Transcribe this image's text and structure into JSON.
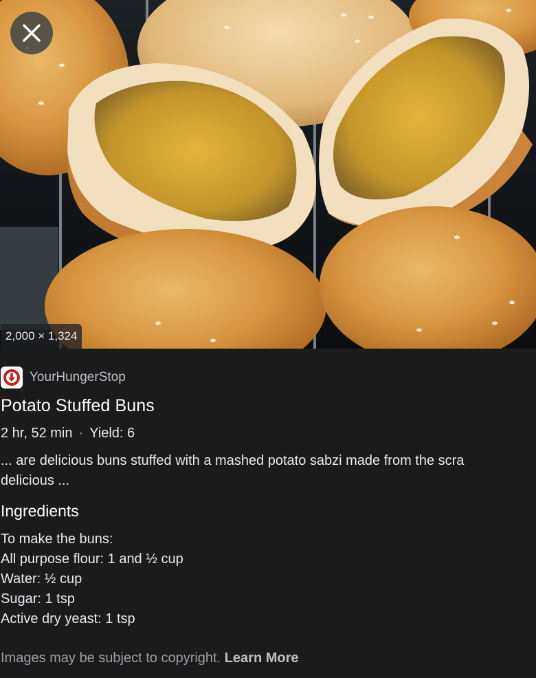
{
  "image": {
    "dimensions_label": "2,000 × 1,324",
    "close_icon": "close-icon"
  },
  "source": {
    "favicon_icon": "down-arrow-badge-icon",
    "favicon_color": "#c5221f",
    "name": "YourHungerStop"
  },
  "recipe": {
    "title": "Potato Stuffed Buns",
    "time": "2 hr, 52 min",
    "separator": "·",
    "yield": "Yield: 6",
    "snippet_lines": [
      "... are delicious buns stuffed with a mashed potato sabzi made from the scra",
      "delicious ..."
    ]
  },
  "ingredients": {
    "heading": "Ingredients",
    "items": [
      "To make the buns:",
      "All purpose flour: 1 and ½ cup",
      "Water: ½ cup",
      "Sugar: 1 tsp",
      "Active dry yeast: 1 tsp"
    ]
  },
  "footer": {
    "copyright_text": "Images may be subject to copyright.",
    "learn_more": "Learn More"
  },
  "colors": {
    "background": "#1b1b1c",
    "text_primary": "#e8eaed",
    "text_secondary": "#9aa0a6"
  }
}
